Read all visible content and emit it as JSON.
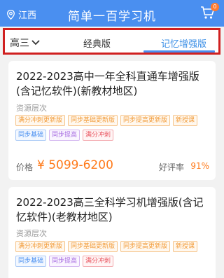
{
  "header": {
    "location": "江西",
    "title": "简单一百学习机",
    "cart_count": "0"
  },
  "tabbar": {
    "grade": "高三",
    "tabs": [
      "经典版",
      "记忆增强版"
    ],
    "active_tab": 1
  },
  "products": [
    {
      "title": "2022-2023高中一年全科直通车增强版(含记忆软件)(新教材地区)",
      "level_label": "资源层次",
      "tags_row1": [
        "满分冲刺更新版",
        "同步基础更新版",
        "同步提高更新版",
        "新授课"
      ],
      "tags_row2": [
        "同步基础",
        "同步提高",
        "满分冲刺"
      ],
      "price_label": "价格",
      "price": "¥ 5099-6200",
      "rating_label": "好评率",
      "rating": "91%"
    },
    {
      "title": "2022-2023高三全科学习机增强版(含记忆软件)(老教材地区)",
      "level_label": "资源层次",
      "tags_row1": [
        "满分冲刺更新版",
        "同步基础更新版",
        "同步提高更新版",
        "新授课"
      ],
      "tags_row2": [
        "同步基础",
        "同步提高",
        "满分冲刺"
      ]
    }
  ],
  "colors": {
    "header": "#4a8ff0",
    "accent": "#ff7a1a",
    "highlight_border": "#d02020"
  }
}
